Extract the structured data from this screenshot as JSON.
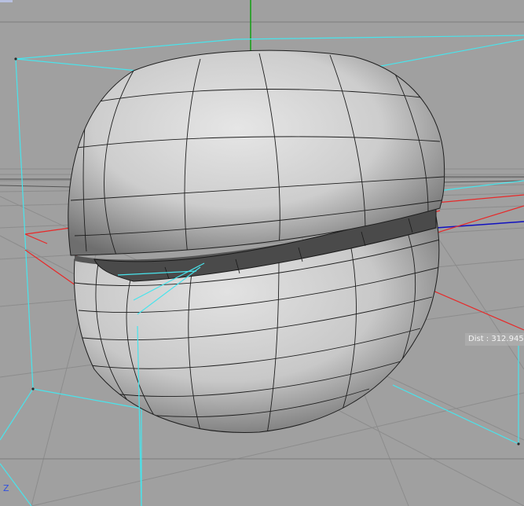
{
  "viewport": {
    "name": "3D viewport",
    "distance_readout": "Dist : 312.945",
    "axis_label": "Z",
    "colors": {
      "background": "#a0a0a0",
      "bounding_box": "#48e4ec",
      "selection_plane": "#e82828",
      "y_axis": "#10a010",
      "x_axis": "#1010c0",
      "wireframe": "#202020"
    },
    "object": {
      "type": "subdivided sphere",
      "state": "split into upper and lower halves"
    }
  }
}
